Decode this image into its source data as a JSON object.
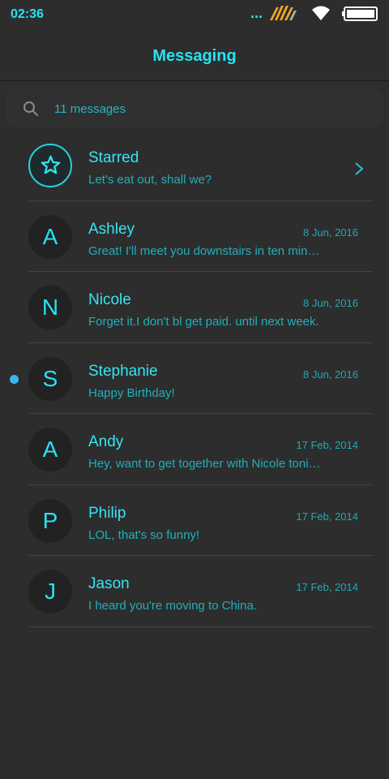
{
  "status_bar": {
    "time": "02:36",
    "signal_dots": "...",
    "carrier_icon": "carrier-stripes-icon",
    "wifi_icon": "wifi-icon",
    "battery_icon": "battery-icon",
    "battery_level": 1.0
  },
  "header": {
    "title": "Messaging"
  },
  "search": {
    "icon": "search-icon",
    "count_label": "11 messages"
  },
  "starred": {
    "icon": "star-icon",
    "title": "Starred",
    "preview": "Let's eat out, shall we?",
    "chevron_icon": "chevron-right-icon"
  },
  "conversations": [
    {
      "initial": "A",
      "name": "Ashley",
      "date": "8 Jun, 2016",
      "preview": "Great! I'll meet you downstairs in ten minutes.",
      "unread": false
    },
    {
      "initial": "N",
      "name": "Nicole",
      "date": "8 Jun, 2016",
      "preview": "Forget it.I don't bl get paid. until next week.",
      "unread": false
    },
    {
      "initial": "S",
      "name": "Stephanie",
      "date": "8 Jun, 2016",
      "preview": "Happy Birthday!",
      "unread": true
    },
    {
      "initial": "A",
      "name": "Andy",
      "date": "17 Feb, 2014",
      "preview": "Hey, want to get together with Nicole tonight?",
      "unread": false
    },
    {
      "initial": "P",
      "name": "Philip",
      "date": "17 Feb, 2014",
      "preview": "LOL, that's so funny!",
      "unread": false
    },
    {
      "initial": "J",
      "name": "Jason",
      "date": "17 Feb, 2014",
      "preview": "I heard you're moving to China.",
      "unread": false
    }
  ],
  "colors": {
    "background": "#2d2d2d",
    "accent": "#26e3f0",
    "secondary_text": "#21afbb",
    "unread_dot": "#38b6f2",
    "carrier_orange": "#f5a623"
  }
}
